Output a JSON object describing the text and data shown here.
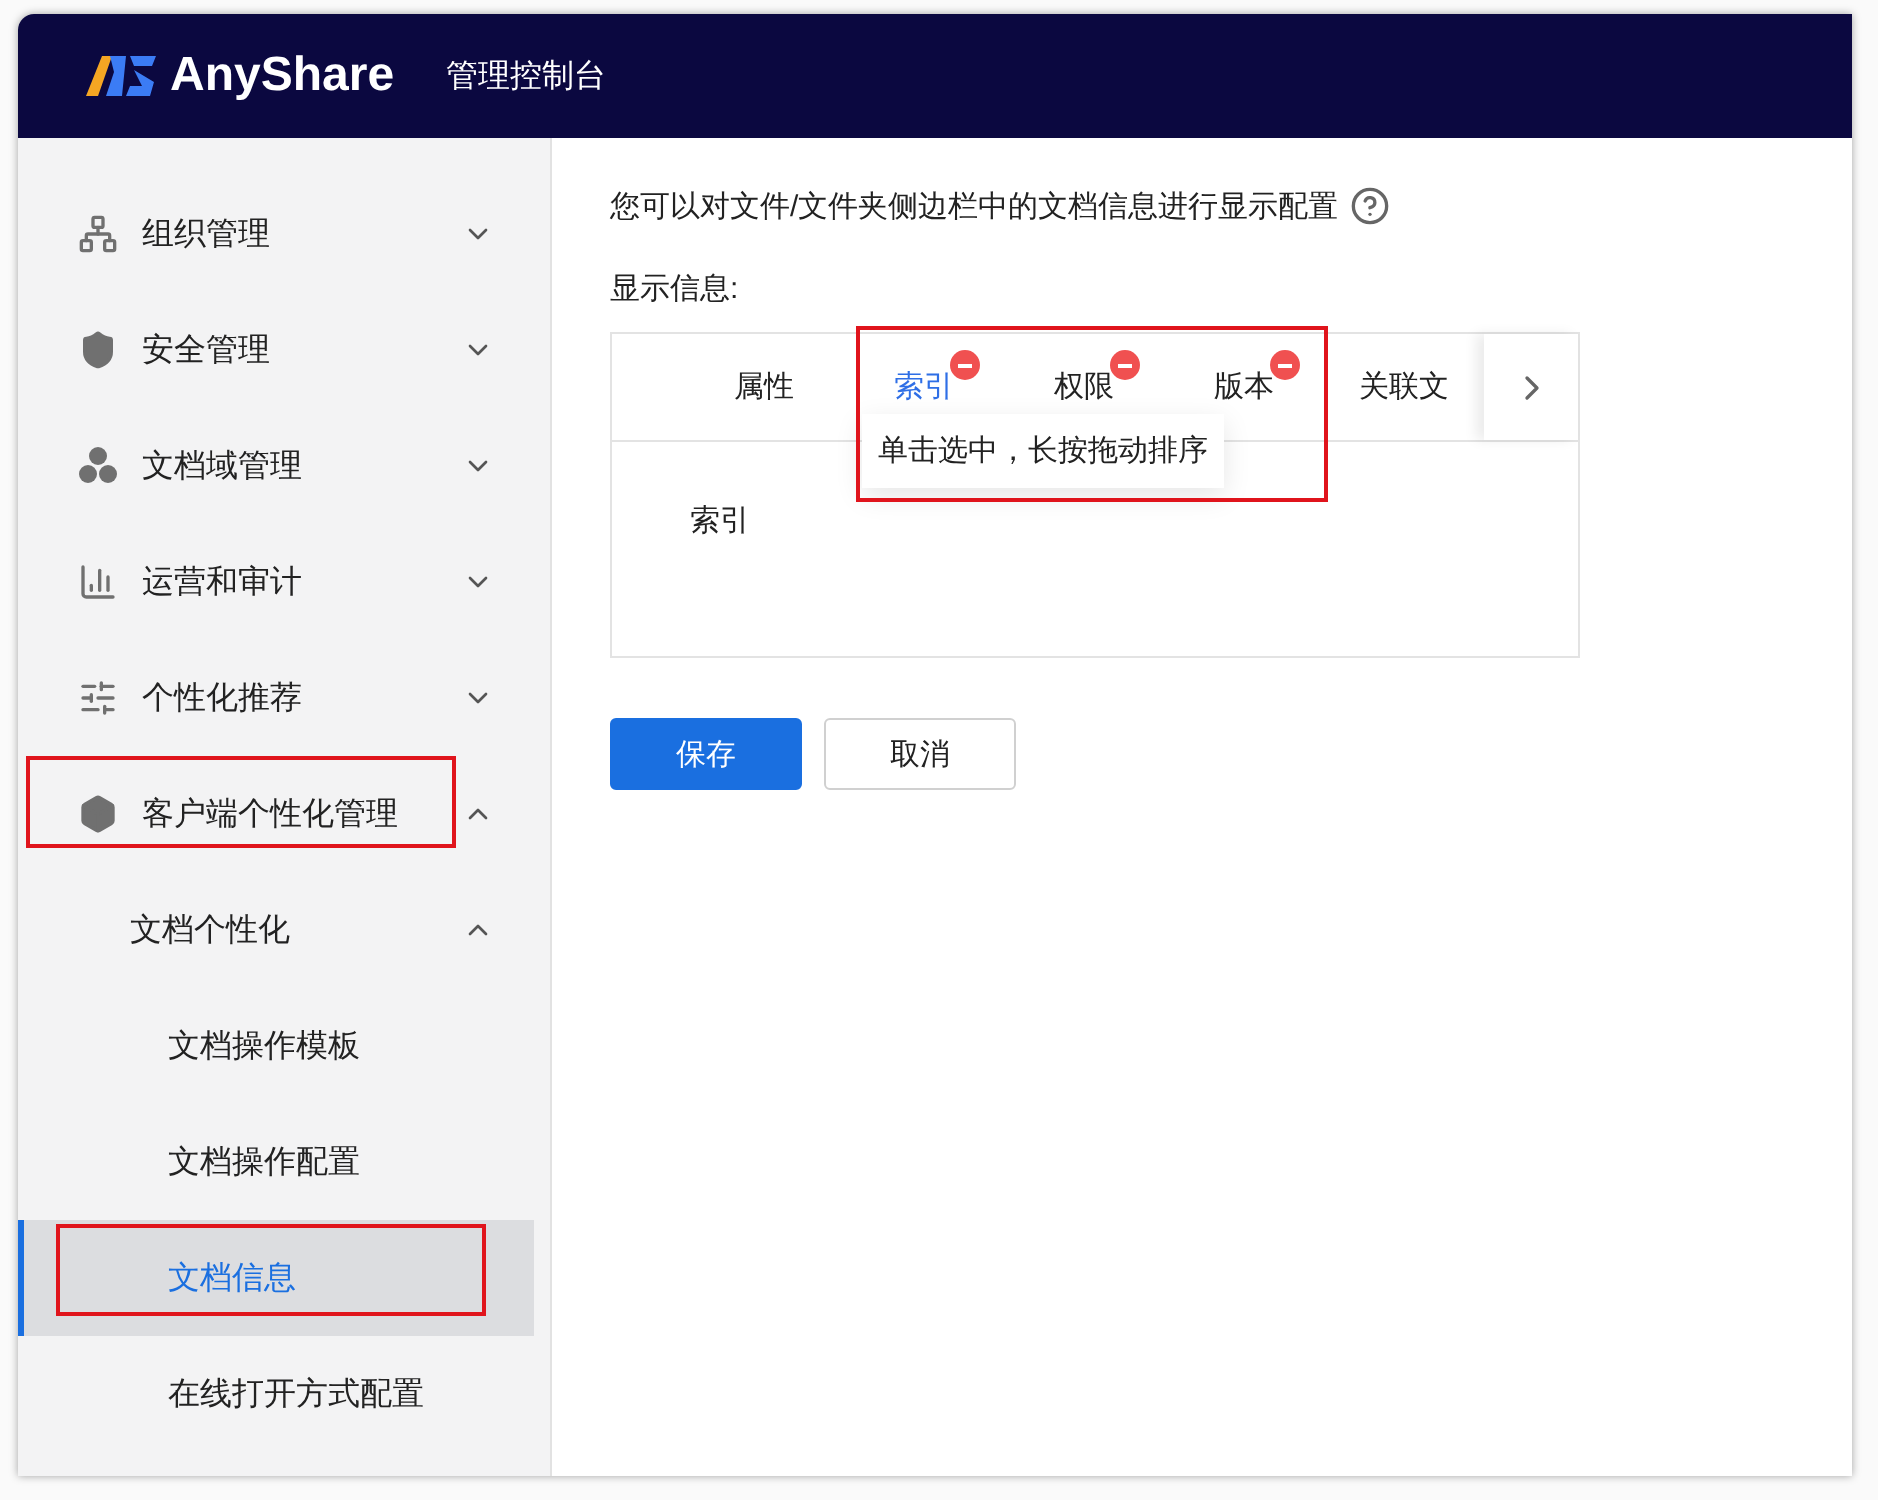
{
  "header": {
    "brand": "AnyShare",
    "title": "管理控制台"
  },
  "sidebar": {
    "items": [
      {
        "label": "组织管理",
        "expanded": false,
        "highlighted": false
      },
      {
        "label": "安全管理",
        "expanded": false,
        "highlighted": false
      },
      {
        "label": "文档域管理",
        "expanded": false,
        "highlighted": false
      },
      {
        "label": "运营和审计",
        "expanded": false,
        "highlighted": false
      },
      {
        "label": "个性化推荐",
        "expanded": false,
        "highlighted": false
      },
      {
        "label": "客户端个性化管理",
        "expanded": true,
        "highlighted": true,
        "children": [
          {
            "label": "文档个性化",
            "expanded": true,
            "children": [
              {
                "label": "文档操作模板",
                "selected": false,
                "highlighted": false
              },
              {
                "label": "文档操作配置",
                "selected": false,
                "highlighted": false
              },
              {
                "label": "文档信息",
                "selected": true,
                "highlighted": true
              },
              {
                "label": "在线打开方式配置",
                "selected": false,
                "highlighted": false
              }
            ]
          }
        ]
      }
    ]
  },
  "content": {
    "description": "您可以对文件/文件夹侧边栏中的文档信息进行显示配置",
    "section_label": "显示信息:",
    "tab_strip": {
      "annotated": true,
      "tooltip": "单击选中，长按拖动排序",
      "tabs": [
        {
          "label": "属性",
          "selected": false,
          "removable": false
        },
        {
          "label": "索引",
          "selected": true,
          "removable": true
        },
        {
          "label": "权限",
          "selected": false,
          "removable": true
        },
        {
          "label": "版本",
          "selected": false,
          "removable": true
        },
        {
          "label": "关联文",
          "selected": false,
          "removable": false
        }
      ]
    },
    "body_text": "索引",
    "buttons": [
      {
        "label": "保存",
        "kind": "primary"
      },
      {
        "label": "取消",
        "kind": "default"
      }
    ]
  }
}
